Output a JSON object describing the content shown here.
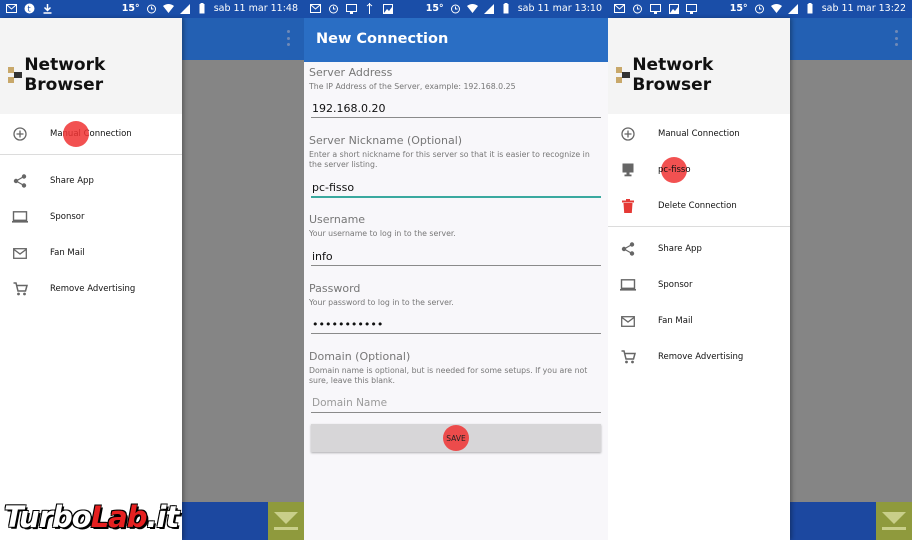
{
  "screens": [
    {
      "status": {
        "temp": "15°",
        "datetime": "sab 11 mar 11:48"
      },
      "app_title": "Network Browser",
      "menu": [
        {
          "label": "Manual Connection",
          "icon": "add-circle-icon"
        },
        {
          "label": "Share App",
          "icon": "share-icon"
        },
        {
          "label": "Sponsor",
          "icon": "laptop-icon"
        },
        {
          "label": "Fan Mail",
          "icon": "mail-icon"
        },
        {
          "label": "Remove Advertising",
          "icon": "cart-icon"
        }
      ]
    },
    {
      "status": {
        "temp": "15°",
        "datetime": "sab 11 mar 13:10"
      },
      "title": "New Connection",
      "fields": {
        "server_address": {
          "label": "Server Address",
          "help": "The IP Address of the Server, example: 192.168.0.25",
          "value": "192.168.0.20"
        },
        "nickname": {
          "label": "Server Nickname (Optional)",
          "help": "Enter a short nickname for this server so that it is easier to recognize in the server listing.",
          "value": "pc-fisso"
        },
        "username": {
          "label": "Username",
          "help": "Your username to log in to the server.",
          "value": "info"
        },
        "password": {
          "label": "Password",
          "help": "Your password to log in to the server.",
          "value": "•••••••••••"
        },
        "domain": {
          "label": "Domain (Optional)",
          "help": "Domain name is optional, but is needed for some setups. If you are not sure, leave this blank.",
          "placeholder": "Domain Name"
        }
      },
      "save_label": "SAVE"
    },
    {
      "status": {
        "temp": "15°",
        "datetime": "sab 11 mar 13:22"
      },
      "app_title": "Network Browser",
      "menu_top": [
        {
          "label": "Manual Connection",
          "icon": "add-circle-icon"
        },
        {
          "label": "pc-fisso",
          "icon": "desktop-icon"
        },
        {
          "label": "Delete Connection",
          "icon": "trash-icon"
        }
      ],
      "menu": [
        {
          "label": "Share App",
          "icon": "share-icon"
        },
        {
          "label": "Sponsor",
          "icon": "laptop-icon"
        },
        {
          "label": "Fan Mail",
          "icon": "mail-icon"
        },
        {
          "label": "Remove Advertising",
          "icon": "cart-icon"
        }
      ]
    }
  ],
  "watermark": {
    "part1": "Turbo",
    "part2": "Lab",
    "part3": ".it"
  },
  "colors": {
    "status_bar": "#1a4ea8",
    "app_bar": "#2a6ec4",
    "focus": "#3aa99f",
    "delete": "#e53935"
  }
}
